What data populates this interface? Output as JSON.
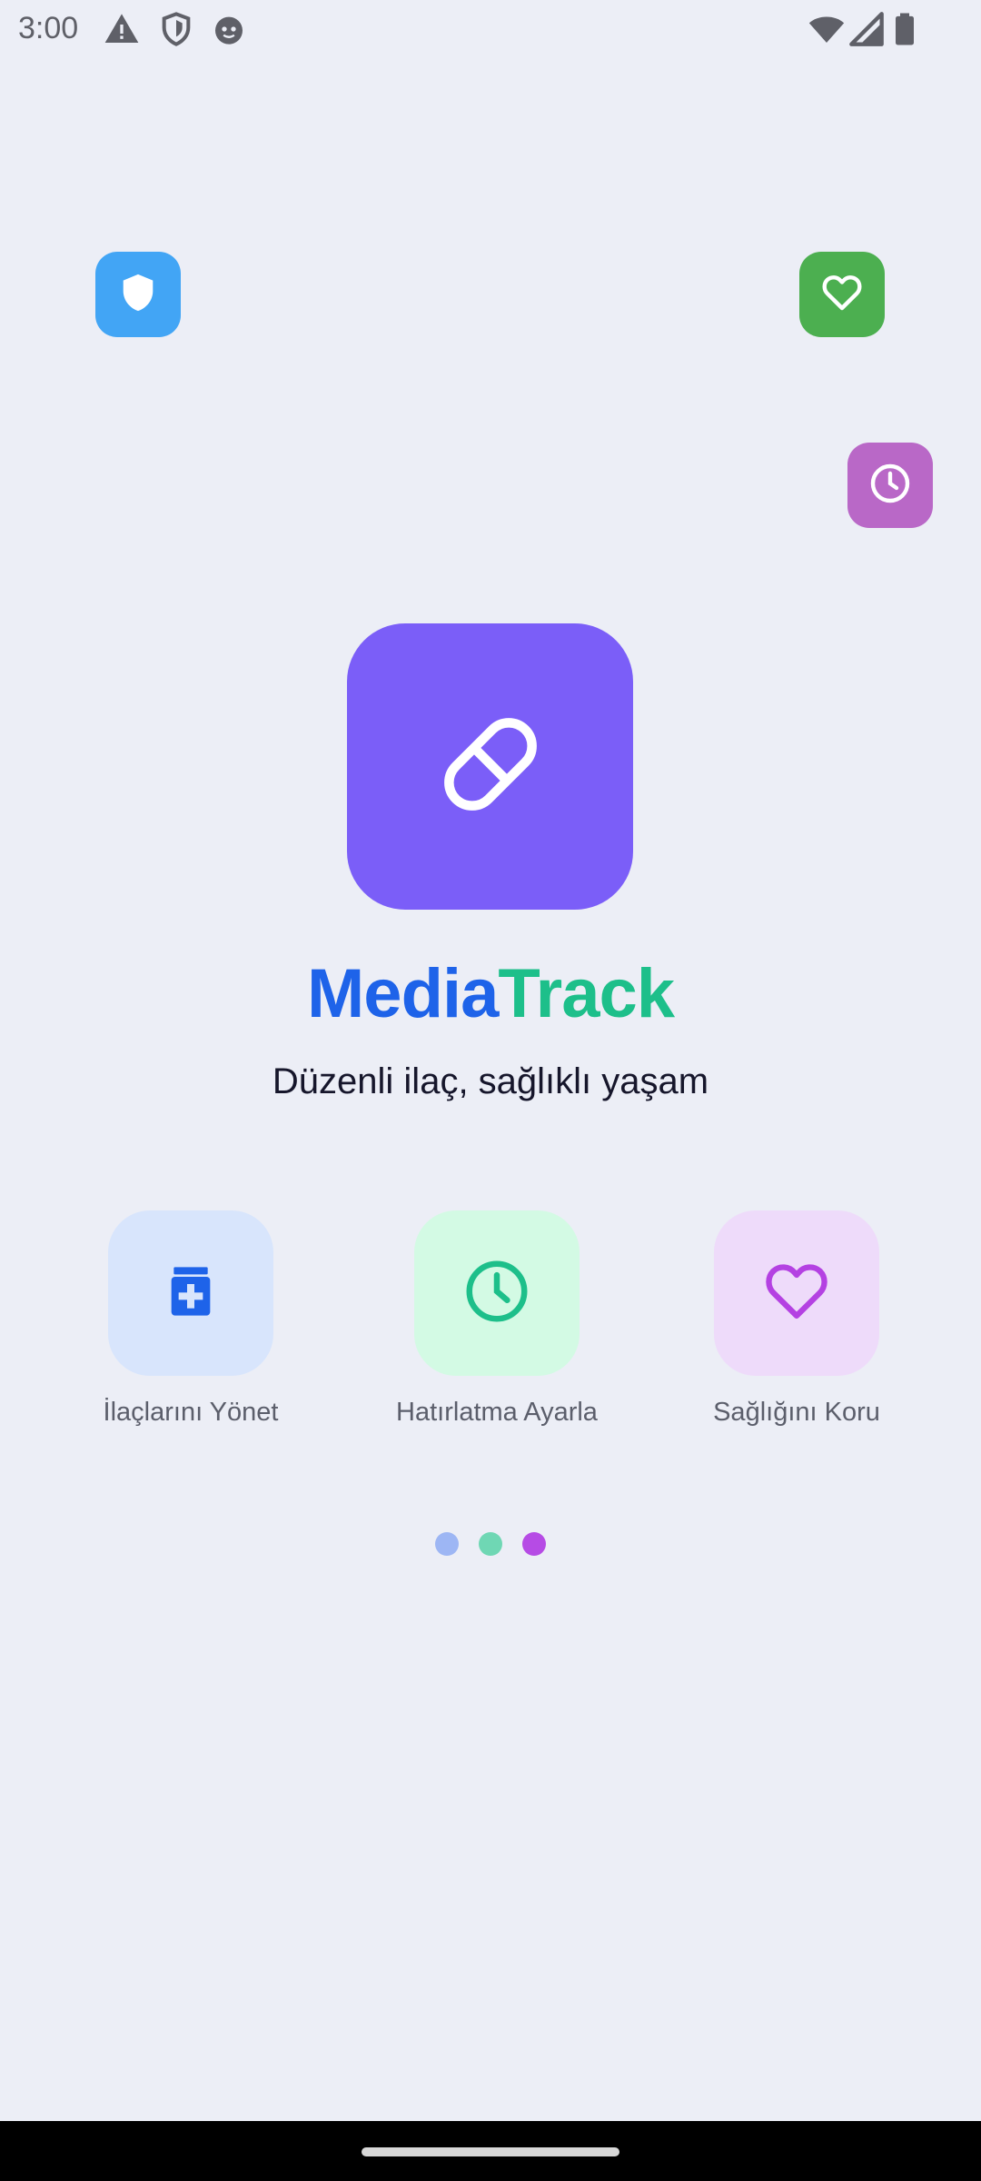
{
  "status_bar": {
    "time": "3:00",
    "left_icons": [
      "warning-icon",
      "shield-outline-icon",
      "face-icon"
    ],
    "right_icons": [
      "wifi-icon",
      "signal-icon",
      "battery-icon"
    ]
  },
  "floating_icons": [
    {
      "name": "shield-icon",
      "color": "#42A5F5"
    },
    {
      "name": "heart-icon",
      "color": "#4CAF50"
    },
    {
      "name": "clock-icon",
      "color": "#B968C7"
    }
  ],
  "logo": {
    "icon": "pill-icon",
    "color": "#7B5EF8"
  },
  "brand": {
    "part1": "Media",
    "part2": "Track",
    "part1_color": "#1E63E9",
    "part2_color": "#1DBF8A"
  },
  "tagline": "Düzenli ilaç, sağlıklı yaşam",
  "features": [
    {
      "label": "İlaçlarını Yönet",
      "icon": "medicine-bottle-icon",
      "bg": "#D8E5FC",
      "fg": "#1E63E9"
    },
    {
      "label": "Hatırlatma Ayarla",
      "icon": "clock-icon",
      "bg": "#D3FAE4",
      "fg": "#1DBF8A"
    },
    {
      "label": "Sağlığını Koru",
      "icon": "heart-icon",
      "bg": "#EEDBFA",
      "fg": "#B441E2"
    }
  ],
  "page_indicator": {
    "colors": [
      "#9DB6F4",
      "#6FD7B4",
      "#B64BE5"
    ]
  }
}
